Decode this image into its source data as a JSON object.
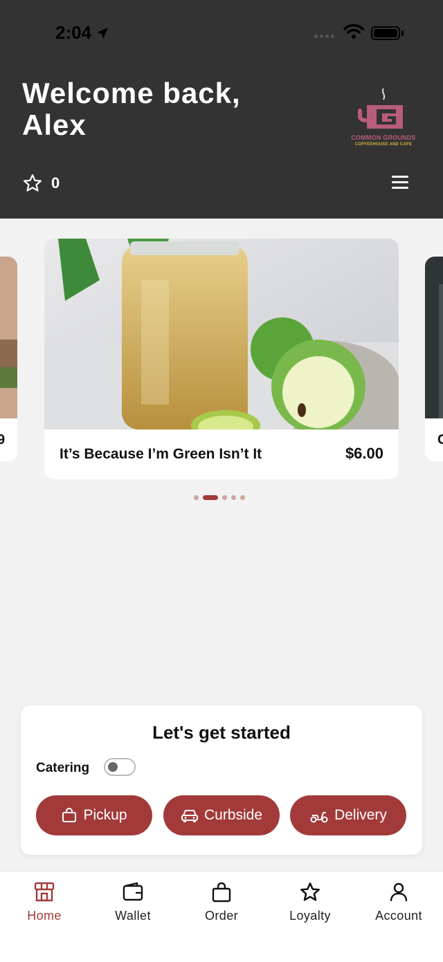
{
  "status_bar": {
    "time": "2:04"
  },
  "header": {
    "welcome_line1": "Welcome back,",
    "welcome_line2": "Alex",
    "points": "0",
    "logo_name": "COMMON GROUNDS",
    "logo_sub": "COFFEEHOUSE AND CAFE"
  },
  "carousel": {
    "main_item": {
      "title": "It’s Because I’m Green Isn’t It",
      "price": "$6.00"
    },
    "left_item_text": "9",
    "right_item_text": "C",
    "dots": [
      {
        "active": false
      },
      {
        "active": true
      },
      {
        "active": false
      },
      {
        "active": false
      },
      {
        "active": false
      }
    ]
  },
  "start": {
    "title": "Let's get started",
    "catering_label": "Catering",
    "catering_on": false,
    "buttons": {
      "pickup": "Pickup",
      "curbside": "Curbside",
      "delivery": "Delivery"
    }
  },
  "tabs": [
    {
      "label": "Home",
      "icon": "store-icon",
      "active": true
    },
    {
      "label": "Wallet",
      "icon": "wallet-icon",
      "active": false
    },
    {
      "label": "Order",
      "icon": "bag-icon",
      "active": false
    },
    {
      "label": "Loyalty",
      "icon": "star-icon",
      "active": false
    },
    {
      "label": "Account",
      "icon": "person-icon",
      "active": false
    }
  ],
  "colors": {
    "header_bg": "#333333",
    "accent": "#a33a3a",
    "dot_inactive": "#d2a4a4",
    "logo_pink": "#b85c7a",
    "logo_gold": "#d9b23c"
  }
}
